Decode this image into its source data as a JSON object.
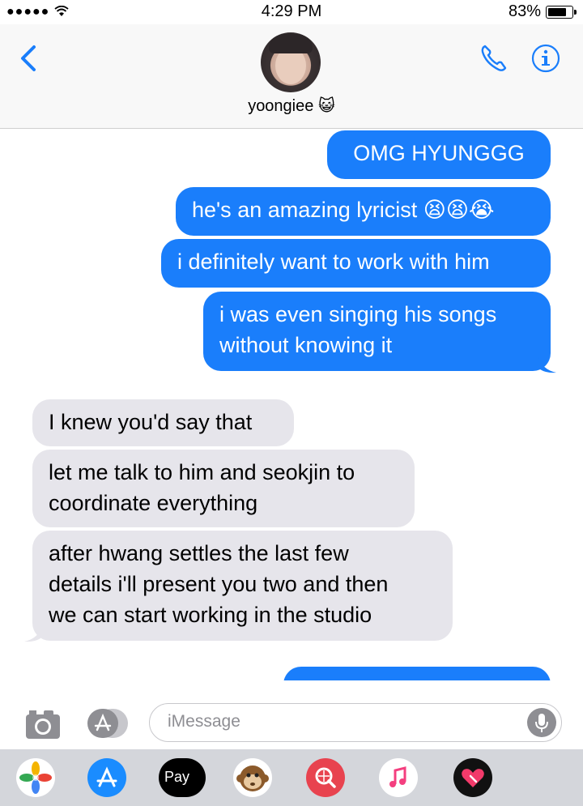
{
  "status_bar": {
    "signal": "●●●●●",
    "time": "4:29 PM",
    "battery_percent": "83%"
  },
  "header": {
    "contact_name": "yoongiee",
    "contact_emoji": "😺"
  },
  "messages": [
    {
      "side": "out",
      "text": "OMG HYUNGGG"
    },
    {
      "side": "out",
      "text": "he's an amazing lyricist 😫😫😭"
    },
    {
      "side": "out",
      "text": "i definitely want to work with him"
    },
    {
      "side": "out",
      "text": "i was even singing his songs\nwithout knowing it"
    },
    {
      "side": "in",
      "text": "I knew you'd say that"
    },
    {
      "side": "in",
      "text": "let me talk to him and seokjin to\ncoordinate everything"
    },
    {
      "side": "in",
      "text": "after hwang settles the last few\ndetails i'll present you two and then\nwe can start working in the studio"
    }
  ],
  "composer": {
    "placeholder": "iMessage"
  },
  "app_tray": {
    "apple_pay_label": " Pay",
    "apps": [
      "photos-icon",
      "app-store-icon",
      "apple-pay-icon",
      "animoji-monkey-icon",
      "web-search-icon",
      "music-icon",
      "digital-touch-icon"
    ]
  },
  "colors": {
    "accent": "#1a7efb",
    "incoming_bubble": "#e6e5eb"
  }
}
